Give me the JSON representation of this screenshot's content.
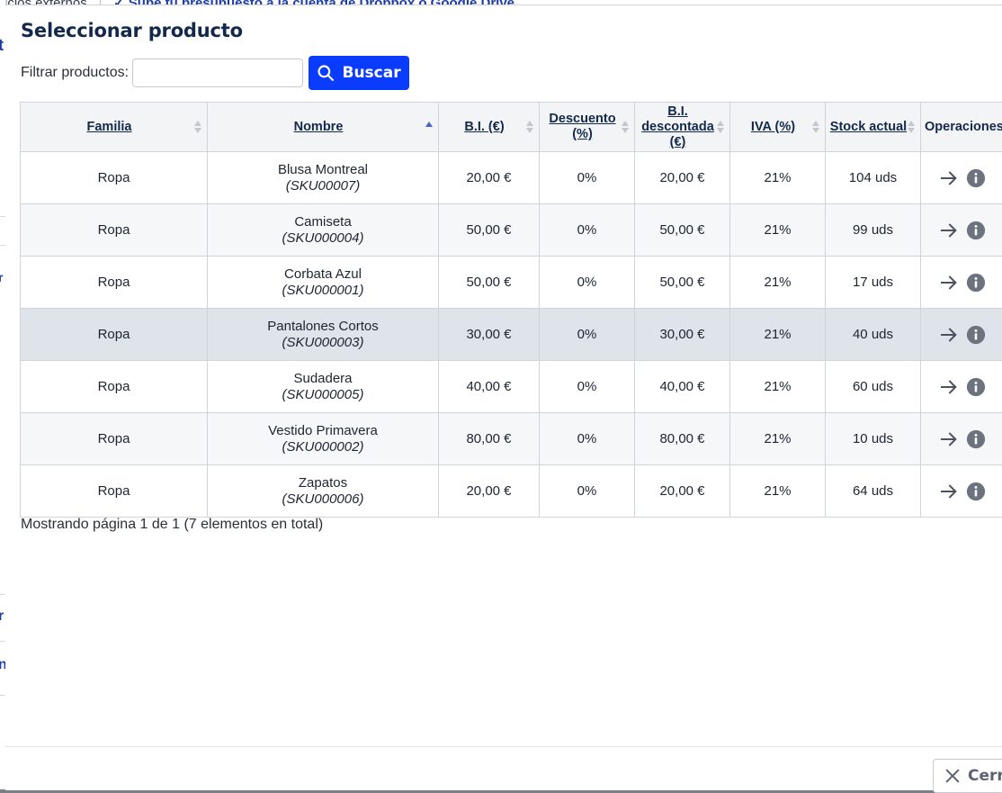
{
  "background": {
    "top_fragment": "ricios externos",
    "top_link": "✓ Sube tu presupuesto a la cuenta de Dropbox o Google Drive",
    "left_fragments": [
      "t",
      "r",
      "r",
      "n"
    ]
  },
  "modal": {
    "title": "Seleccionar producto",
    "filter_label": "Filtrar productos:",
    "filter_value": "",
    "filter_placeholder": "",
    "search_button": "Buscar",
    "close_button": "Cerr"
  },
  "table": {
    "headers": {
      "familia": "Familia",
      "nombre": "Nombre",
      "bi": "B.I. (€)",
      "descuento_1": "Descuento",
      "descuento_2": "(%)",
      "bi_desc_1": "B.I.",
      "bi_desc_2": "descontada",
      "bi_desc_3": "(€)",
      "iva": "IVA (%)",
      "stock": "Stock actual",
      "operaciones": "Operaciones"
    },
    "rows": [
      {
        "familia": "Ropa",
        "nombre": "Blusa Montreal",
        "sku": "(SKU00007)",
        "bi": "20,00 €",
        "descuento": "0%",
        "bi_desc": "20,00 €",
        "iva": "21%",
        "stock": "104 uds"
      },
      {
        "familia": "Ropa",
        "nombre": "Camiseta",
        "sku": "(SKU000004)",
        "bi": "50,00 €",
        "descuento": "0%",
        "bi_desc": "50,00 €",
        "iva": "21%",
        "stock": "99 uds"
      },
      {
        "familia": "Ropa",
        "nombre": "Corbata Azul",
        "sku": "(SKU000001)",
        "bi": "50,00 €",
        "descuento": "0%",
        "bi_desc": "50,00 €",
        "iva": "21%",
        "stock": "17 uds"
      },
      {
        "familia": "Ropa",
        "nombre": "Pantalones Cortos",
        "sku": "(SKU000003)",
        "bi": "30,00 €",
        "descuento": "0%",
        "bi_desc": "30,00 €",
        "iva": "21%",
        "stock": "40 uds"
      },
      {
        "familia": "Ropa",
        "nombre": "Sudadera",
        "sku": "(SKU000005)",
        "bi": "40,00 €",
        "descuento": "0%",
        "bi_desc": "40,00 €",
        "iva": "21%",
        "stock": "60 uds"
      },
      {
        "familia": "Ropa",
        "nombre": "Vestido Primavera",
        "sku": "(SKU000002)",
        "bi": "80,00 €",
        "descuento": "0%",
        "bi_desc": "80,00 €",
        "iva": "21%",
        "stock": "10 uds"
      },
      {
        "familia": "Ropa",
        "nombre": "Zapatos",
        "sku": "(SKU000006)",
        "bi": "20,00 €",
        "descuento": "0%",
        "bi_desc": "20,00 €",
        "iva": "21%",
        "stock": "64 uds"
      }
    ],
    "icons": {
      "select": "arrow-right-icon",
      "details": "info-icon"
    }
  },
  "pagination": {
    "text": "Mostrando página 1 de 1 (7 elementos en total)"
  },
  "colors": {
    "primary": "#0a3cff",
    "title": "#13294b",
    "highlight_row": "#dfe3ea"
  }
}
